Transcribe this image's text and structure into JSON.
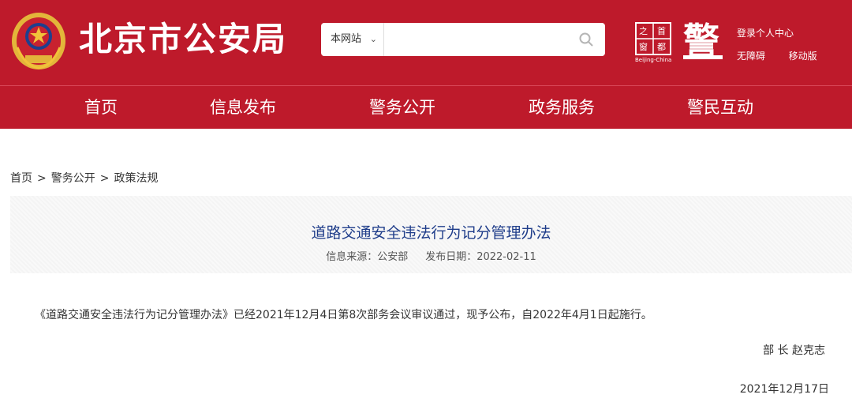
{
  "header": {
    "site_title": "北京市公安局",
    "search": {
      "scope_label": "本网站",
      "placeholder": "",
      "value": ""
    },
    "logo_capital_text": "首都之窗",
    "logo_capital_sub": "Beijing-China",
    "logo_police_text": "警",
    "links": {
      "login": "登录个人中心",
      "accessibility": "无障碍",
      "mobile": "移动版"
    },
    "colors": {
      "brand_red": "#be1a2b",
      "title_blue": "#1f3d8a"
    }
  },
  "nav": {
    "items": [
      {
        "label": "首页"
      },
      {
        "label": "信息发布"
      },
      {
        "label": "警务公开"
      },
      {
        "label": "政务服务"
      },
      {
        "label": "警民互动"
      }
    ]
  },
  "breadcrumb": {
    "items": [
      "首页",
      "警务公开",
      "政策法规"
    ],
    "separator": ">"
  },
  "article": {
    "title": "道路交通安全违法行为记分管理办法",
    "source_label": "信息来源：公安部",
    "date_label": "发布日期：2022-02-11",
    "body": "《道路交通安全违法行为记分管理办法》已经2021年12月4日第8次部务会议审议通过，现予公布，自2022年4月1日起施行。",
    "signer": "部 长 赵克志",
    "sign_date": "2021年12月17日"
  },
  "icons": {
    "emblem": "police-emblem-icon",
    "search": "search-icon",
    "scope_dropdown": "chevron-down-icon"
  }
}
